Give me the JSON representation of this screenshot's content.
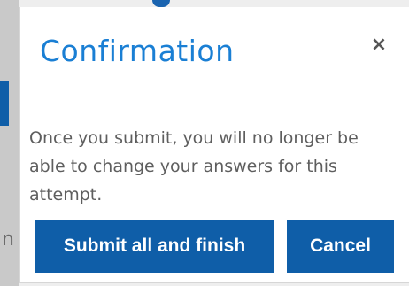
{
  "dialog": {
    "title": "Confirmation",
    "close_icon": "close-icon",
    "close_glyph": "×",
    "message": "Once you submit, you will no longer be able to change your answers for this attempt.",
    "buttons": {
      "submit_label": "Submit all and finish",
      "cancel_label": "Cancel"
    }
  },
  "background": {
    "partial_text": "n"
  },
  "colors": {
    "title": "#1a7fd4",
    "primary_button": "#0f5ea8",
    "button_text": "#ffffff",
    "body_text": "#5e5e5e"
  }
}
